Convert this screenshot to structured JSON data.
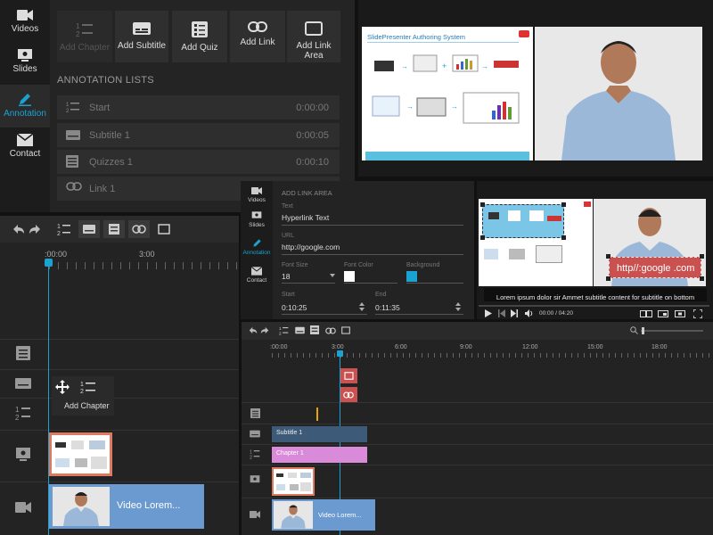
{
  "nav": {
    "videos": "Videos",
    "slides": "Slides",
    "annotation": "Annotation",
    "contact": "Contact"
  },
  "toolbar": {
    "add_chapter": "Add Chapter",
    "add_subtitle": "Add Subtitle",
    "add_quiz": "Add Quiz",
    "add_link": "Add Link",
    "add_link_area": "Add Link Area"
  },
  "annotations": {
    "heading": "ANNOTATION LISTS",
    "items": [
      {
        "label": "Start",
        "time": "0:00:00",
        "icon": "chapter-icon"
      },
      {
        "label": "Subtitle 1",
        "time": "0:00:05",
        "icon": "subtitle-icon"
      },
      {
        "label": "Quizzes 1",
        "time": "0:00:10",
        "icon": "quiz-icon"
      },
      {
        "label": "Link 1",
        "time": "",
        "icon": "link-icon"
      }
    ]
  },
  "slide": {
    "title": "SlidePresenter Authoring System"
  },
  "timeline_left": {
    "ticks": [
      ":00:00",
      "3:00"
    ],
    "drag_tooltip": "Add Chapter",
    "video_label": "Video Lorem..."
  },
  "link_area_form": {
    "heading": "ADD LINK AREA",
    "text_label": "Text",
    "text_value": "Hyperlink Text",
    "url_label": "URL",
    "url_value": "http://google.com",
    "font_size_label": "Font Size",
    "font_size_value": "18",
    "font_color_label": "Font Color",
    "font_color_value": "#ffffff",
    "background_label": "Background",
    "background_value": "#1aa3d1",
    "start_label": "Start",
    "start_value": "0:10:25",
    "end_label": "End",
    "end_value": "0:11:35"
  },
  "preview": {
    "link_overlay": "http//:google .com",
    "subtitle": "Lorem ipsum dolor sir Ammet subtitle content for subtitle on bottom",
    "time": "00:00 / 04:20"
  },
  "timeline_right": {
    "ticks": [
      ":00:00",
      "3:00",
      "6:00",
      "9:00",
      "12:00",
      "15:00",
      "18:00"
    ],
    "subtitle_clip": "Subtitle 1",
    "chapter_clip": "Chapter 1",
    "video_label": "Video Lorem..."
  },
  "colors": {
    "accent": "#1aa3d1",
    "subtitle_clip": "#3d5a78",
    "chapter_clip": "#d98ad9",
    "video_clip": "#6a9ad0",
    "link_marker": "#c9514f",
    "slide_clip_border": "#e07a5f"
  }
}
